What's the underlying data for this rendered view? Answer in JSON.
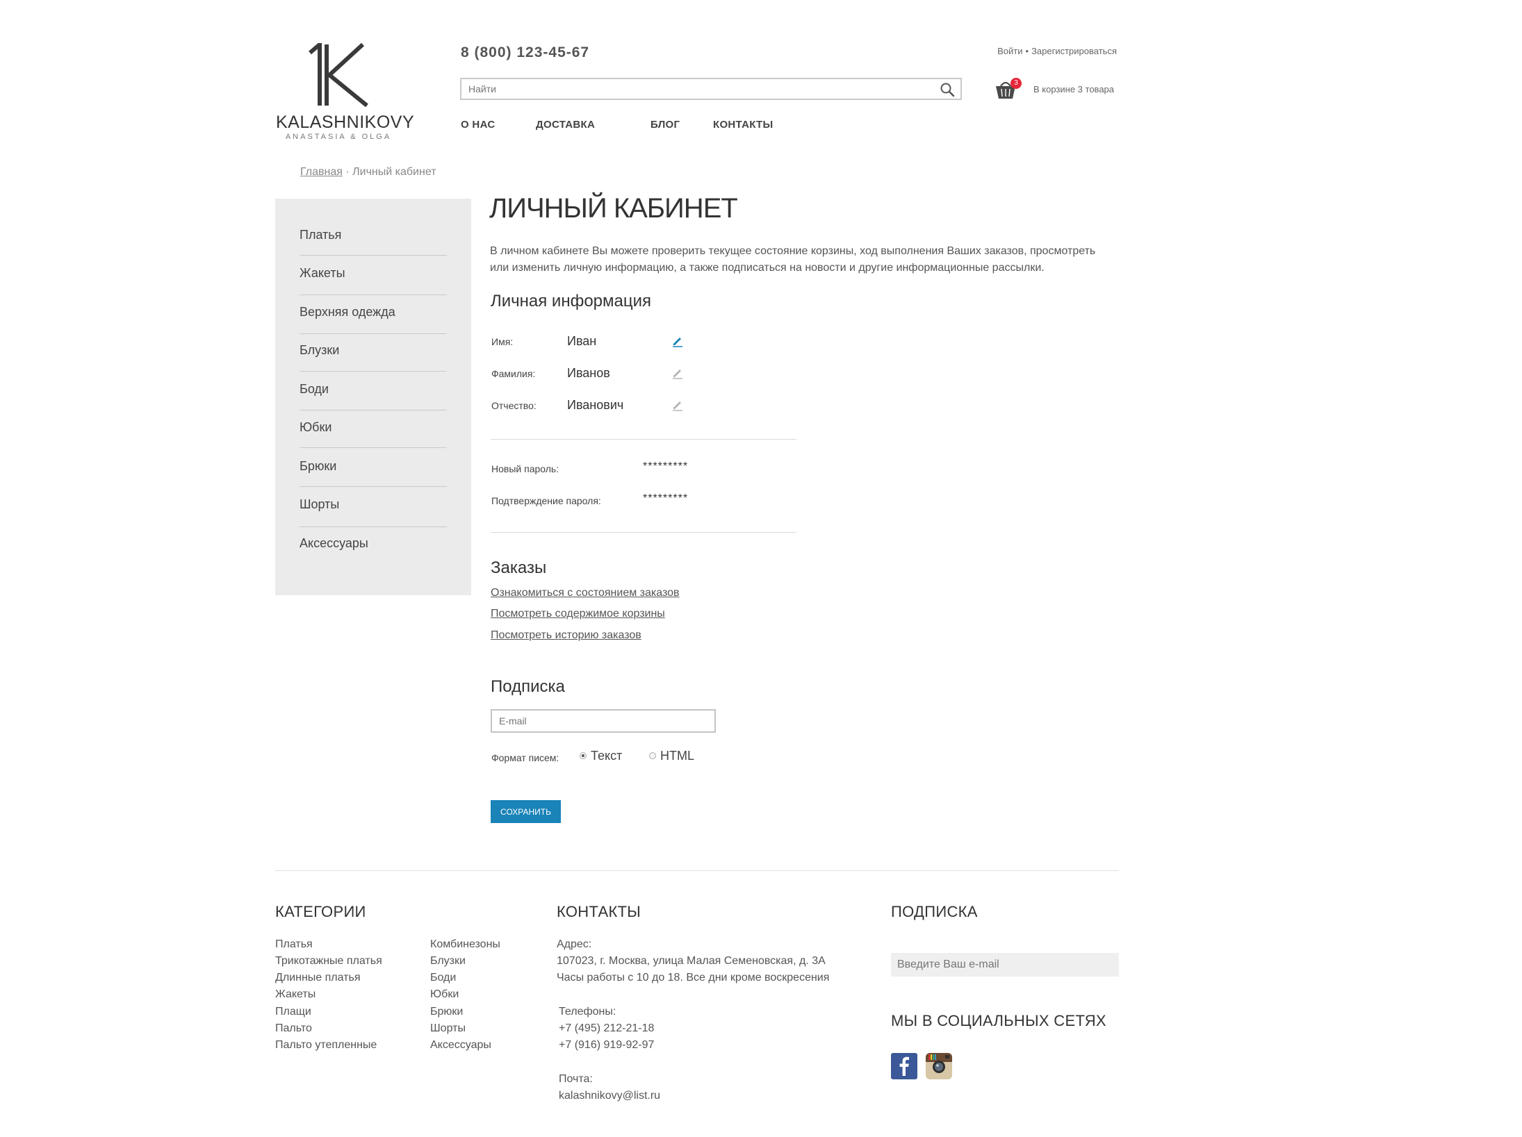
{
  "header": {
    "logo": {
      "name": "KALASHNIKOVY",
      "sub": "ANASTASIA & OLGA"
    },
    "phone": "8 (800) 123-45-67",
    "auth": {
      "login": "Войти",
      "separator": "•",
      "register": "Зарегистрироваться"
    },
    "search": {
      "placeholder": "Найти"
    },
    "cart": {
      "count": "3",
      "text": "В корзине 3 товара"
    },
    "nav": [
      "О НАС",
      "ДОСТАВКА",
      "БЛОГ",
      "КОНТАКТЫ"
    ]
  },
  "breadcrumb": {
    "home": "Главная",
    "separator": "·",
    "current": "Личный кабинет"
  },
  "sidebar": {
    "items": [
      "Платья",
      "Жакеты",
      "Верхняя одежда",
      "Блузки",
      "Боди",
      "Юбки",
      "Брюки",
      "Шорты",
      "Аксессуары"
    ]
  },
  "main": {
    "title": "ЛИЧНЫЙ КАБИНЕТ",
    "intro": "В личном кабинете Вы можете проверить текущее состояние корзины, ход выполнения Ваших заказов, просмотреть или изменить личную информацию, а также подписаться на новости и другие информационные рассылки.",
    "personal": {
      "heading": "Личная информация",
      "first_name": {
        "label": "Имя:",
        "value": "Иван"
      },
      "last_name": {
        "label": "Фамилия:",
        "value": "Иванов"
      },
      "patronymic": {
        "label": "Отчество:",
        "value": "Иванович"
      },
      "new_password": {
        "label": "Новый пароль:",
        "value": "*********"
      },
      "confirm_password": {
        "label": "Подтверждение пароля:",
        "value": "*********"
      }
    },
    "orders": {
      "heading": "Заказы",
      "links": [
        "Ознакомиться с состоянием заказов",
        "Посмотреть содержимое корзины",
        "Посмотреть историю заказов"
      ]
    },
    "subscription": {
      "heading": "Подписка",
      "email_placeholder": "E-mail",
      "format_label": "Формат писем:",
      "options": [
        "Текст",
        "HTML"
      ],
      "selected": "Текст",
      "save_label": "Сохранить"
    }
  },
  "footer": {
    "categories": {
      "title": "КАТЕГОРИИ",
      "col1": [
        "Платья",
        "Трикотажные платья",
        "Длинные платья",
        "Жакеты",
        "Плащи",
        "Пальто",
        "Пальто утепленные"
      ],
      "col2": [
        "Комбинезоны",
        "Блузки",
        "Боди",
        "Юбки",
        "Брюки",
        "Шорты",
        "Аксессуары"
      ]
    },
    "contacts": {
      "title": "КОНТАКТЫ",
      "address_label": "Адрес:",
      "address": "107023, г. Москва, улица Малая Семеновская, д. 3А",
      "hours": "Часы работы с 10 до 18. Все дни кроме воскресения",
      "phones_label": "Телефоны:",
      "phone1": "+7 (495) 212-21-18",
      "phone2": "+7 (916) 919-92-97",
      "mail_label": "Почта:",
      "mail": "kalashnikovy@list.ru"
    },
    "subscribe": {
      "title": "ПОДПИСКА",
      "placeholder": "Введите Ваш e-mail"
    },
    "social": {
      "title": "МЫ В СОЦИАЛЬНЫХ СЕТЯХ",
      "icons": [
        "facebook-icon",
        "instagram-icon"
      ]
    }
  },
  "colors": {
    "accent": "#1a83b8",
    "badge": "#e8263a",
    "sidebar_bg": "#ebebeb",
    "facebook": "#3b5998"
  }
}
